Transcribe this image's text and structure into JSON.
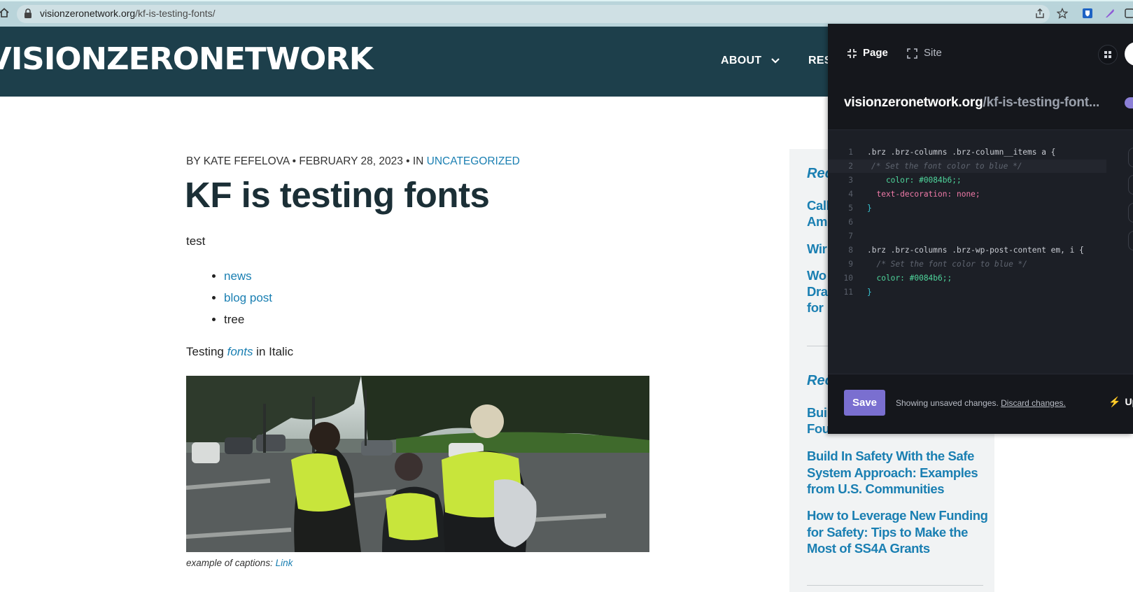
{
  "browser": {
    "url_domain": "visionzeronetwork.org",
    "url_path": "/kf-is-testing-fonts/"
  },
  "site": {
    "logo_text": "VISIONZERONETWORK",
    "nav": {
      "about": "ABOUT",
      "resources": "RES"
    }
  },
  "article": {
    "byline": {
      "prefix": "BY KATE FEFELOVA • FEBRUARY 28, 2023 • IN ",
      "category": "UNCATEGORIZED"
    },
    "title": "KF is testing fonts",
    "intro": "test",
    "list_items": [
      "news",
      "blog post",
      "tree"
    ],
    "italic_sentence": {
      "before": "Testing ",
      "link": "fonts",
      "after": " in Italic"
    },
    "caption": {
      "text": "example of captions: ",
      "link": "Link"
    }
  },
  "sidebar": {
    "heading_1": "Rec",
    "items_top": [
      "Call",
      "Am",
      "Wir",
      "Wo",
      "Dra",
      "for"
    ],
    "heading_2": "Rec",
    "items_mid": [
      "Buil",
      "Fou"
    ],
    "items_full": [
      "Build In Safety With the Safe System Approach: Examples from U.S. Communities",
      "How to Leverage New Funding for Safety: Tips to Make the Most of SS4A Grants"
    ]
  },
  "editor": {
    "tabs": {
      "page": "Page",
      "site": "Site"
    },
    "url_domain": "visionzeronetwork.org",
    "url_path": "/kf-is-testing-font...",
    "code_lines": [
      ".brz .brz-columns .brz-column__items a {",
      "/* Set the font color to blue */",
      "    color: #0084b6;;",
      "  text-decoration: none;",
      "}",
      "",
      "",
      ".brz .brz-columns .brz-wp-post-content em, i {",
      "  /* Set the font color to blue */",
      "  color: #0084b6;;",
      "}"
    ],
    "save_label": "Save",
    "unsaved_text": "Showing unsaved changes. ",
    "discard_link": "Discard changes.",
    "upgrade_label": "Upgr",
    "colors": {
      "accent": "#7a6fd0",
      "panel_bg": "#15171c",
      "link": "#1a7fb2",
      "header_bg": "#1d3f4b"
    }
  }
}
